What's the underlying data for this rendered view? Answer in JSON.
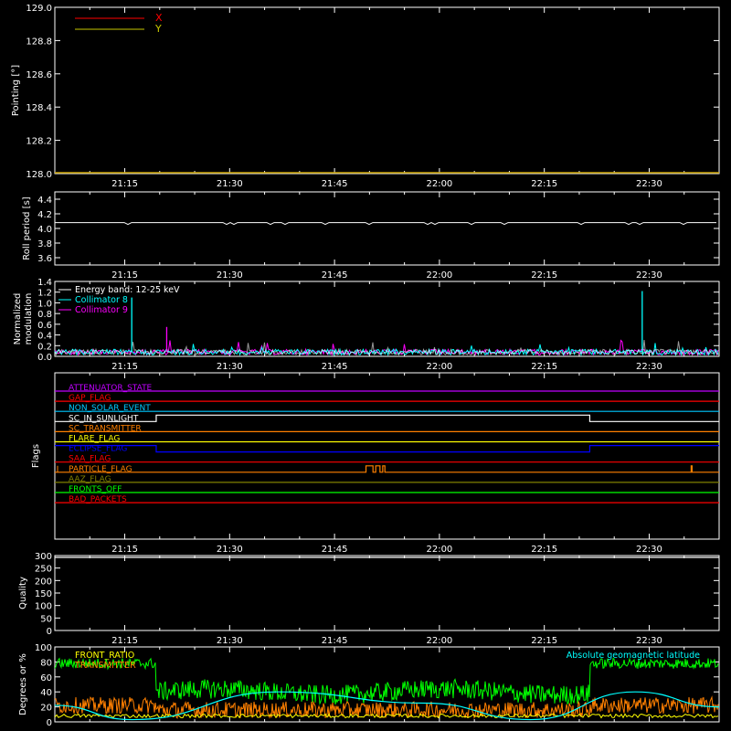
{
  "chart_data": [
    {
      "type": "line",
      "ylabel": "Pointing [°]",
      "ylim": [
        128.0,
        129.0
      ],
      "yticks": [
        "129.0",
        "128.8",
        "128.6",
        "128.4",
        "128.2",
        "128.0"
      ],
      "xticks": [
        "21:15",
        "21:30",
        "21:45",
        "22:00",
        "22:15",
        "22:30"
      ],
      "legend": [
        {
          "name": "X",
          "color": "#ff0000"
        },
        {
          "name": "Y",
          "color": "#c8c800"
        }
      ],
      "series": [
        {
          "name": "X",
          "color": "#ff0000",
          "values": []
        },
        {
          "name": "Y",
          "color": "#c8a000",
          "values": [
            128.0,
            128.0
          ]
        }
      ]
    },
    {
      "type": "line",
      "ylabel": "Roll period [s]",
      "ylim": [
        3.5,
        4.5
      ],
      "yticks": [
        "4.4",
        "4.2",
        "4.0",
        "3.8",
        "3.6"
      ],
      "xticks": [
        "21:15",
        "21:30",
        "21:45",
        "22:00",
        "22:15",
        "22:30"
      ],
      "series": [
        {
          "name": "Roll period",
          "color": "#ffffff",
          "values": [
            4.08,
            4.08
          ]
        }
      ]
    },
    {
      "type": "line",
      "ylabel": "Normalized modulation",
      "ylim": [
        0.0,
        1.4
      ],
      "yticks": [
        "1.4",
        "1.2",
        "1.0",
        "0.8",
        "0.6",
        "0.4",
        "0.2",
        "0.0"
      ],
      "xticks": [
        "21:15",
        "21:30",
        "21:45",
        "22:00",
        "22:15",
        "22:30"
      ],
      "legend": [
        {
          "name": "Energy band: 12-25 keV",
          "color": "#ffffff"
        },
        {
          "name": "Collimator 8",
          "color": "#00ffff"
        },
        {
          "name": "Collimator 9",
          "color": "#ff00ff"
        }
      ],
      "spikes": [
        {
          "series": "Collimator 8",
          "x": "21:16",
          "y": 1.1
        },
        {
          "series": "Collimator 9",
          "x": "21:21",
          "y": 0.55
        },
        {
          "series": "Collimator 8",
          "x": "22:29",
          "y": 1.22
        }
      ],
      "baseline": 0.08
    },
    {
      "type": "line",
      "ylabel": "Flags",
      "xticks": [
        "21:15",
        "21:30",
        "21:45",
        "22:00",
        "22:15",
        "22:30"
      ],
      "flags": [
        {
          "label": "ATTENUATOR_STATE",
          "color": "#c000ff"
        },
        {
          "label": "GAP_FLAG",
          "color": "#ff0000"
        },
        {
          "label": "NON_SOLAR_EVENT",
          "color": "#00c8ff"
        },
        {
          "label": "SC_IN_SUNLIGHT",
          "color": "#ffffff"
        },
        {
          "label": "SC_TRANSMITTER",
          "color": "#ff8000"
        },
        {
          "label": "FLARE_FLAG",
          "color": "#ffff00"
        },
        {
          "label": "ECLIPSE_FLAG",
          "color": "#0000ff"
        },
        {
          "label": "SAA_FLAG",
          "color": "#ff0000"
        },
        {
          "label": "PARTICLE_FLAG",
          "color": "#ff8000"
        },
        {
          "label": "AAZ_FLAG",
          "color": "#808000"
        },
        {
          "label": "FRONTS_OFF",
          "color": "#00ff00"
        },
        {
          "label": "BAD_PACKETS",
          "color": "#ff0000"
        }
      ]
    },
    {
      "type": "line",
      "ylabel": "Quality",
      "ylim": [
        0,
        300
      ],
      "yticks": [
        "300",
        "250",
        "200",
        "150",
        "100",
        "50",
        "0"
      ],
      "xticks": [
        "21:15",
        "21:30",
        "21:45",
        "22:00",
        "22:15",
        "22:30"
      ],
      "series": [
        {
          "name": "Quality",
          "color": "#ffffff",
          "values": [
            300,
            300
          ]
        }
      ]
    },
    {
      "type": "line",
      "ylabel": "Degrees or %",
      "ylim": [
        0,
        100
      ],
      "yticks": [
        "100",
        "80",
        "60",
        "40",
        "20",
        "0"
      ],
      "legend": [
        {
          "name": "FRONT_RATIO",
          "color": "#ffff00"
        },
        {
          "name": "TRANSMITTER",
          "color": "#ff8000"
        },
        {
          "name": "Absolute geomagnetic latitude",
          "color": "#00ffff"
        }
      ],
      "series": [
        {
          "name": "green",
          "color": "#00ff00",
          "level_sunlit": 78,
          "level_eclipse": 40
        },
        {
          "name": "TRANSMITTER",
          "color": "#ff8000",
          "level": 22
        },
        {
          "name": "Absolute geomagnetic latitude",
          "color": "#00ffff",
          "x": [
            "21:05",
            "21:16",
            "21:37",
            "21:58",
            "22:13",
            "22:28",
            "22:40"
          ],
          "values": [
            22,
            3,
            40,
            25,
            3,
            40,
            20
          ]
        }
      ]
    }
  ]
}
